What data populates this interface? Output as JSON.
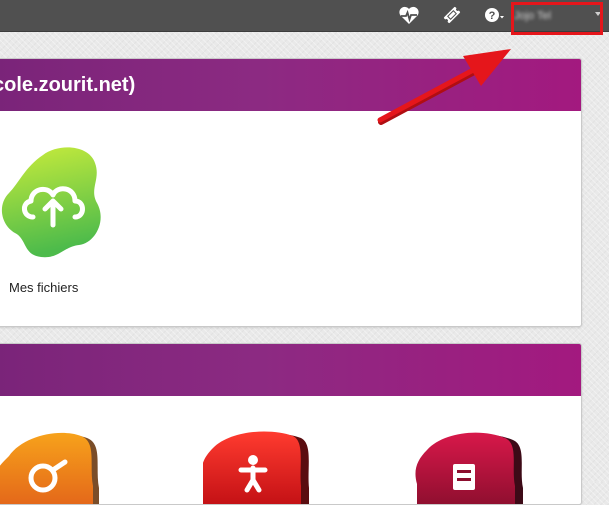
{
  "topbar": {
    "icons": [
      "heartbeat-icon",
      "ticket-icon",
      "help-icon"
    ],
    "user_name": "Jojo Tel",
    "colors": {
      "background": "#505050",
      "highlight": "#e5161b"
    }
  },
  "section1": {
    "title": "cole.zourit.net)",
    "tiles": [
      {
        "label": "Mes fichiers",
        "icon": "cloud-upload-icon"
      }
    ],
    "header_gradient": [
      "#7a2479",
      "#a3197f"
    ]
  },
  "section2": {
    "title": "",
    "tiles": [
      {
        "icon": "orange-app-icon"
      },
      {
        "icon": "red-app-icon"
      },
      {
        "icon": "crimson-app-icon"
      }
    ]
  }
}
